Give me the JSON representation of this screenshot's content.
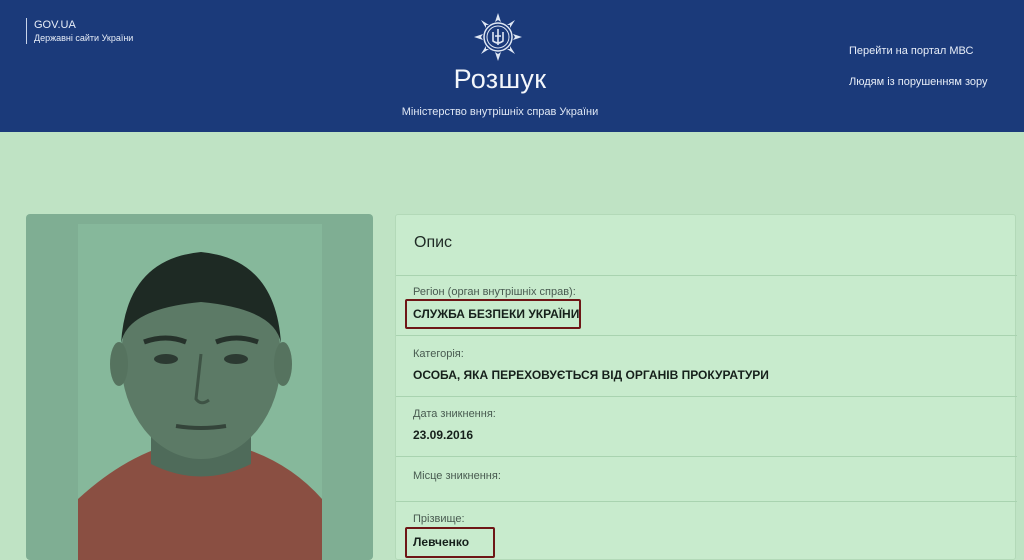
{
  "header": {
    "gov_title": "GOV.UA",
    "gov_subtitle": "Державні сайти України",
    "title": "Розшук",
    "subtitle": "Міністерство внутрішніх справ України",
    "links": [
      "Перейти на портал МВС",
      "Людям із порушенням зору"
    ]
  },
  "description": {
    "heading": "Опис",
    "fields": [
      {
        "label": "Регіон (орган внутрішніх справ):",
        "value": "СЛУЖБА БЕЗПЕКИ УКРАЇНИ"
      },
      {
        "label": "Категорія:",
        "value": "ОСОБА, ЯКА ПЕРЕХОВУЄТЬСЯ ВІД ОРГАНІВ ПРОКУРАТУРИ"
      },
      {
        "label": "Дата зникнення:",
        "value": "23.09.2016"
      },
      {
        "label": "Місце зникнення:",
        "value": ""
      },
      {
        "label": "Прізвище:",
        "value": "Левченко"
      }
    ]
  },
  "colors": {
    "header_bg": "#1b3a7a",
    "page_bg": "#bfe3c4",
    "highlight": "#6e1616"
  }
}
